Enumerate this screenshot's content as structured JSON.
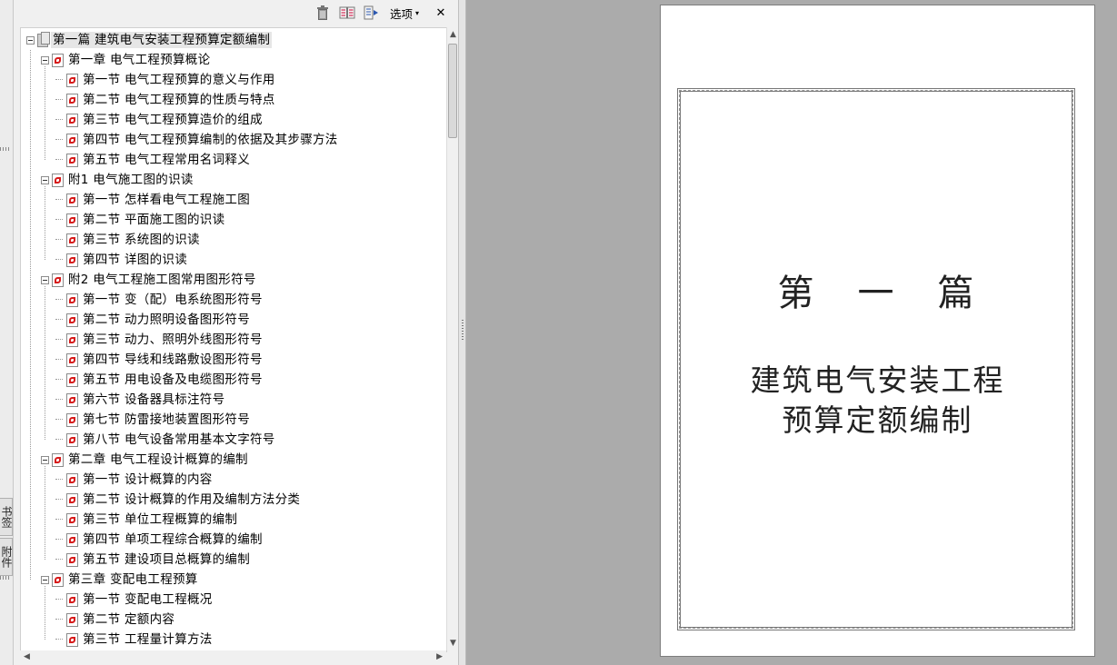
{
  "toolbar": {
    "options_label": "选项",
    "options_caret": "▾",
    "close_glyph": "✕"
  },
  "side_tabs": [
    "书签",
    "附件"
  ],
  "bookmarks": [
    {
      "level": 0,
      "icon": "doc",
      "expanded": true,
      "label": "第一篇 建筑电气安装工程预算定额编制"
    },
    {
      "level": 1,
      "icon": "pdf",
      "expanded": true,
      "label": "第一章  电气工程预算概论"
    },
    {
      "level": 2,
      "icon": "pdf",
      "label": "第一节  电气工程预算的意义与作用"
    },
    {
      "level": 2,
      "icon": "pdf",
      "label": "第二节  电气工程预算的性质与特点"
    },
    {
      "level": 2,
      "icon": "pdf",
      "label": "第三节  电气工程预算造价的组成"
    },
    {
      "level": 2,
      "icon": "pdf",
      "label": "第四节  电气工程预算编制的依据及其步骤方法"
    },
    {
      "level": 2,
      "icon": "pdf",
      "label": "第五节  电气工程常用名词释义"
    },
    {
      "level": 1,
      "icon": "pdf",
      "expanded": true,
      "label": "附1  电气施工图的识读"
    },
    {
      "level": 2,
      "icon": "pdf",
      "label": "第一节  怎样看电气工程施工图"
    },
    {
      "level": 2,
      "icon": "pdf",
      "label": "第二节  平面施工图的识读"
    },
    {
      "level": 2,
      "icon": "pdf",
      "label": "第三节  系统图的识读"
    },
    {
      "level": 2,
      "icon": "pdf",
      "label": "第四节  详图的识读"
    },
    {
      "level": 1,
      "icon": "pdf",
      "expanded": true,
      "label": "附2  电气工程施工图常用图形符号"
    },
    {
      "level": 2,
      "icon": "pdf",
      "label": "第一节  变（配）电系统图形符号"
    },
    {
      "level": 2,
      "icon": "pdf",
      "label": "第二节  动力照明设备图形符号"
    },
    {
      "level": 2,
      "icon": "pdf",
      "label": "第三节  动力、照明外线图形符号"
    },
    {
      "level": 2,
      "icon": "pdf",
      "label": "第四节  导线和线路敷设图形符号"
    },
    {
      "level": 2,
      "icon": "pdf",
      "label": "第五节  用电设备及电缆图形符号"
    },
    {
      "level": 2,
      "icon": "pdf",
      "label": "第六节  设备器具标注符号"
    },
    {
      "level": 2,
      "icon": "pdf",
      "label": "第七节  防雷接地装置图形符号"
    },
    {
      "level": 2,
      "icon": "pdf",
      "label": "第八节  电气设备常用基本文字符号"
    },
    {
      "level": 1,
      "icon": "pdf",
      "expanded": true,
      "label": "第二章  电气工程设计概算的编制"
    },
    {
      "level": 2,
      "icon": "pdf",
      "label": "第一节  设计概算的内容"
    },
    {
      "level": 2,
      "icon": "pdf",
      "label": "第二节  设计概算的作用及编制方法分类"
    },
    {
      "level": 2,
      "icon": "pdf",
      "label": "第三节  单位工程概算的编制"
    },
    {
      "level": 2,
      "icon": "pdf",
      "label": "第四节  单项工程综合概算的编制"
    },
    {
      "level": 2,
      "icon": "pdf",
      "label": "第五节  建设项目总概算的编制"
    },
    {
      "level": 1,
      "icon": "pdf",
      "expanded": true,
      "label": "第三章  变配电工程预算"
    },
    {
      "level": 2,
      "icon": "pdf",
      "label": "第一节  变配电工程概况"
    },
    {
      "level": 2,
      "icon": "pdf",
      "label": "第二节  定额内容"
    },
    {
      "level": 2,
      "icon": "pdf",
      "label": "第三节  工程量计算方法"
    }
  ],
  "page": {
    "heading": "第　一　篇",
    "title_line1": "建筑电气安装工程",
    "title_line2": "预算定额编制"
  }
}
